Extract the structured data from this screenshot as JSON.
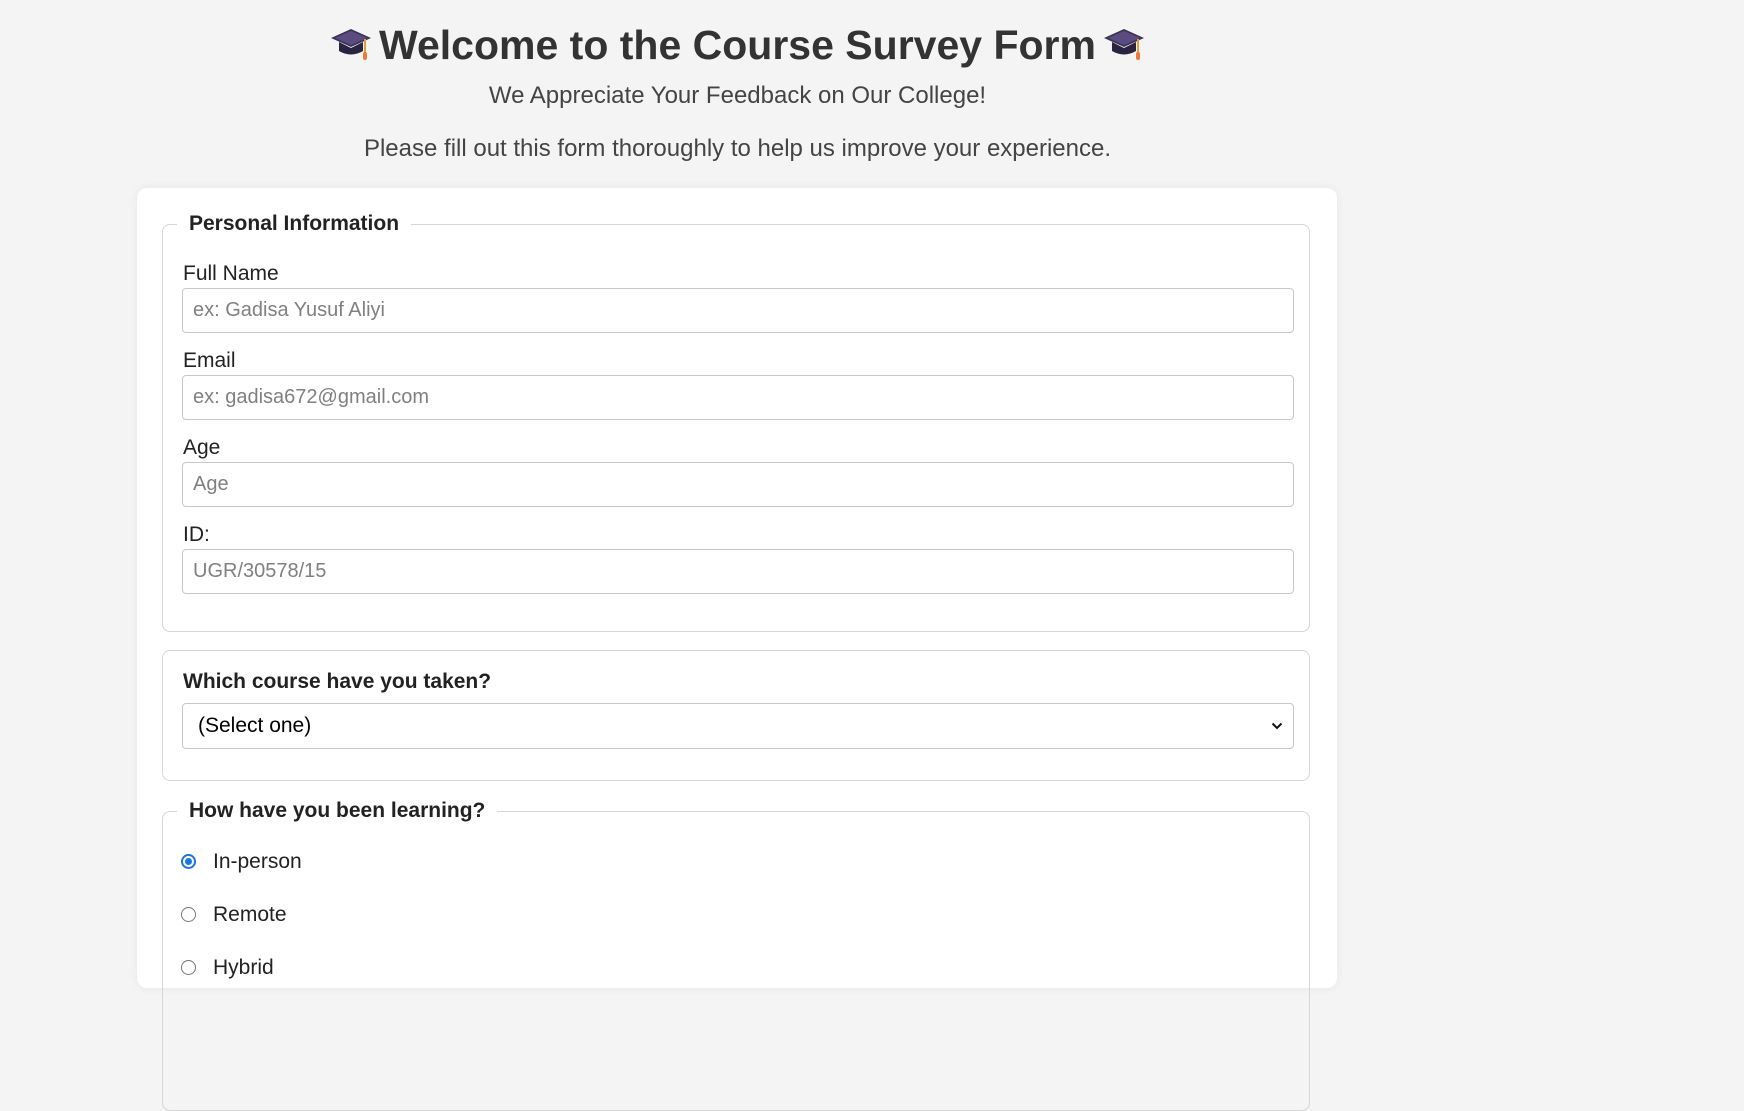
{
  "header": {
    "title": "Welcome to the Course Survey Form",
    "subtitle": "We Appreciate Your Feedback on Our College!",
    "description": "Please fill out this form thoroughly to help us improve your experience."
  },
  "personal_info": {
    "legend": "Personal Information",
    "full_name": {
      "label": "Full Name",
      "value": "",
      "placeholder": "ex: Gadisa Yusuf Aliyi"
    },
    "email": {
      "label": "Email",
      "value": "",
      "placeholder": "ex: gadisa672@gmail.com"
    },
    "age": {
      "label": "Age",
      "value": "",
      "placeholder": "Age"
    },
    "id": {
      "label": "ID:",
      "value": "",
      "placeholder": "UGR/30578/15"
    }
  },
  "course": {
    "label": "Which course have you taken?",
    "selected": "(Select one)"
  },
  "learning": {
    "legend": "How have you been learning?",
    "options": [
      {
        "label": "In-person",
        "checked": true
      },
      {
        "label": "Remote",
        "checked": false
      },
      {
        "label": "Hybrid",
        "checked": false
      }
    ]
  },
  "colors": {
    "background": "#f4f4f4",
    "card": "#ffffff",
    "accent": "#1a73e8",
    "text": "#333333"
  },
  "icons": {
    "title_left": "graduation-cap-icon",
    "title_right": "graduation-cap-icon",
    "select_arrow": "chevron-down-icon"
  }
}
